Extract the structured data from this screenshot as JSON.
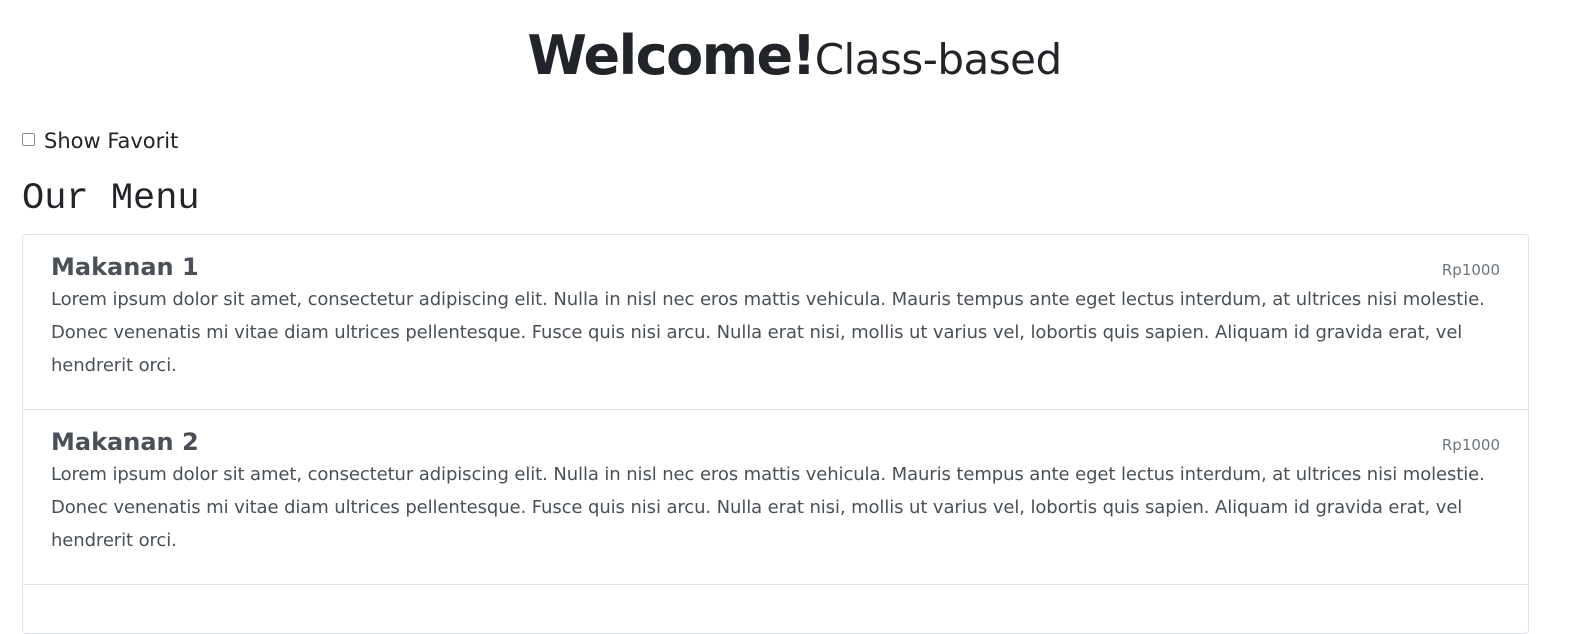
{
  "header": {
    "title": "Welcome!",
    "subtitle": "Class-based"
  },
  "favorit": {
    "label": "Show Favorit",
    "checked": false
  },
  "menu": {
    "heading": "Our Menu",
    "items": [
      {
        "name": "Makanan 1",
        "price": "Rp1000",
        "description": "Lorem ipsum dolor sit amet, consectetur adipiscing elit. Nulla in nisl nec eros mattis vehicula. Mauris tempus ante eget lectus interdum, at ultrices nisi molestie. Donec venenatis mi vitae diam ultrices pellentesque. Fusce quis nisi arcu. Nulla erat nisi, mollis ut varius vel, lobortis quis sapien. Aliquam id gravida erat, vel hendrerit orci."
      },
      {
        "name": "Makanan 2",
        "price": "Rp1000",
        "description": "Lorem ipsum dolor sit amet, consectetur adipiscing elit. Nulla in nisl nec eros mattis vehicula. Mauris tempus ante eget lectus interdum, at ultrices nisi molestie. Donec venenatis mi vitae diam ultrices pellentesque. Fusce quis nisi arcu. Nulla erat nisi, mollis ut varius vel, lobortis quis sapien. Aliquam id gravida erat, vel hendrerit orci."
      }
    ]
  },
  "colors": {
    "text_dark": "#212529",
    "text_muted": "#495057",
    "price": "#6c757d",
    "border": "#dee2e6"
  }
}
